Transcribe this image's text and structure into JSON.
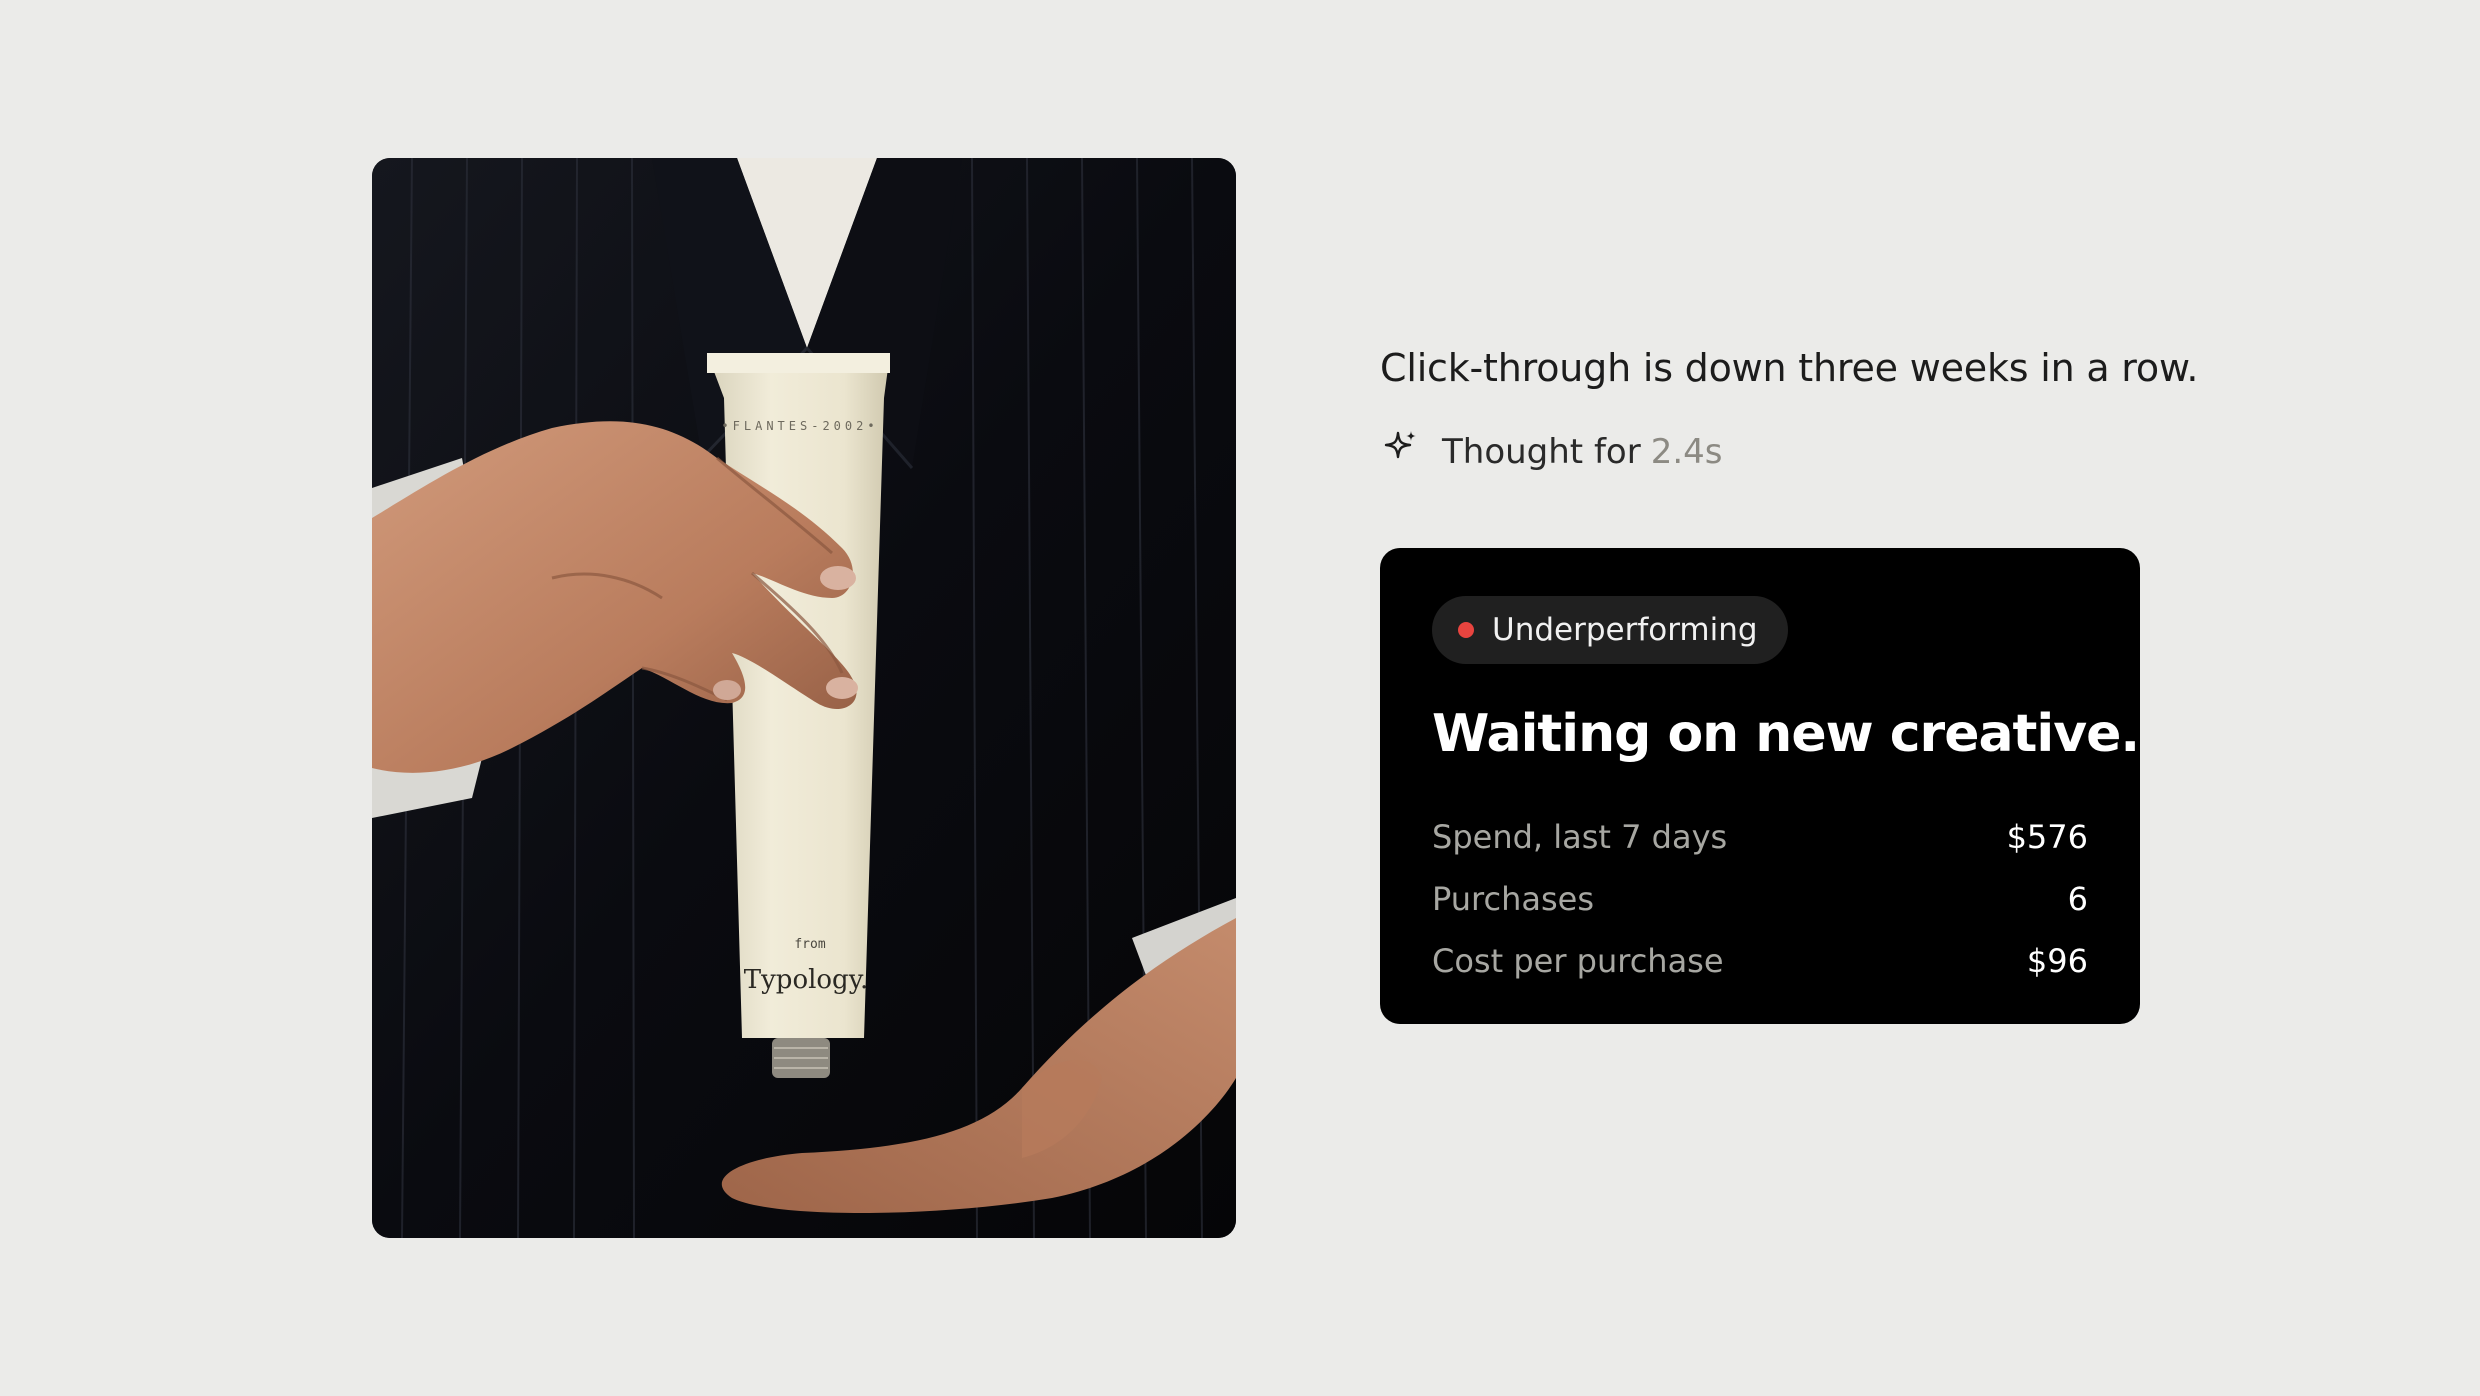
{
  "photo": {
    "alt": "Hands holding a cream tube product in front of a pinstripe suit",
    "tube_top_text": "•FLANTES-2002•",
    "tube_from_text": "from",
    "tube_brand": "Typology."
  },
  "chat": {
    "message": "Click-through is down three weeks in a row.",
    "thought_label": "Thought for",
    "thought_duration": "2.4s",
    "icon": "sparkle-icon"
  },
  "card": {
    "status_label": "Underperforming",
    "status_color": "#e8443f",
    "headline": "Waiting on new creative.",
    "metrics": [
      {
        "label": "Spend, last 7 days",
        "value": "$576"
      },
      {
        "label": "Purchases",
        "value": "6"
      },
      {
        "label": "Cost per purchase",
        "value": "$96"
      }
    ]
  },
  "colors": {
    "page_background": "#ebebe9",
    "card_background": "#000000",
    "badge_background": "#202020",
    "muted_text": "#8c8a83"
  }
}
